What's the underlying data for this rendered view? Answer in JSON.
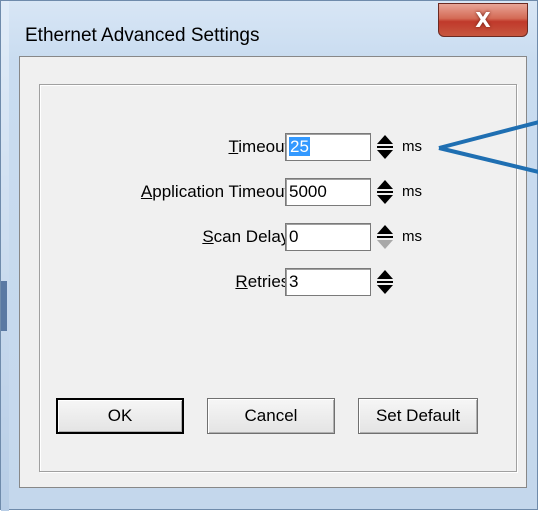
{
  "window": {
    "title": "Ethernet Advanced Settings",
    "close_glyph": "X"
  },
  "fields": [
    {
      "label_mnemonic": "T",
      "label_rest": "imeout:",
      "value": "25",
      "unit": "ms",
      "spinner_down_enabled": true
    },
    {
      "label_mnemonic": "A",
      "label_rest": "pplication Timeout:",
      "value": "5000",
      "unit": "ms",
      "spinner_down_enabled": true
    },
    {
      "label_mnemonic": "S",
      "label_rest": "can Delay:",
      "value": "0",
      "unit": "ms",
      "spinner_down_enabled": false
    },
    {
      "label_mnemonic": "R",
      "label_rest": "etries:",
      "value": "3",
      "unit": "",
      "spinner_down_enabled": true
    }
  ],
  "buttons": {
    "ok": "OK",
    "cancel": "Cancel",
    "set_default": "Set Default"
  },
  "colors": {
    "selection": "#3399ff",
    "close_button": "#c0392b",
    "annotation_line": "#1f6fb2"
  },
  "icons": {
    "spinner": "up-down-arrows-icon",
    "close": "close-icon"
  }
}
